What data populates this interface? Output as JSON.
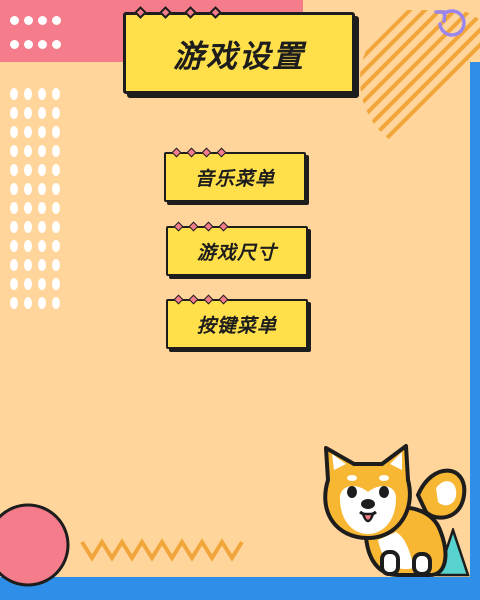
{
  "title": "游戏设置",
  "menu": {
    "items": [
      {
        "label": "音乐菜单"
      },
      {
        "label": "游戏尺寸"
      },
      {
        "label": "按键菜单"
      }
    ]
  },
  "icons": {
    "refresh": "refresh-icon",
    "mascot": "shiba-dog-mascot"
  },
  "colors": {
    "background": "#ffd59b",
    "accent_pink": "#f47c8b",
    "button_yellow": "#ffe04a",
    "frame_blue": "#2f8fe8",
    "outline": "#1d1d1d",
    "stripe_orange": "#f2a53a",
    "zigzag_orange": "#f2a53a",
    "triangle_teal": "#58d3cf",
    "refresh_purple": "#9b86ee"
  }
}
